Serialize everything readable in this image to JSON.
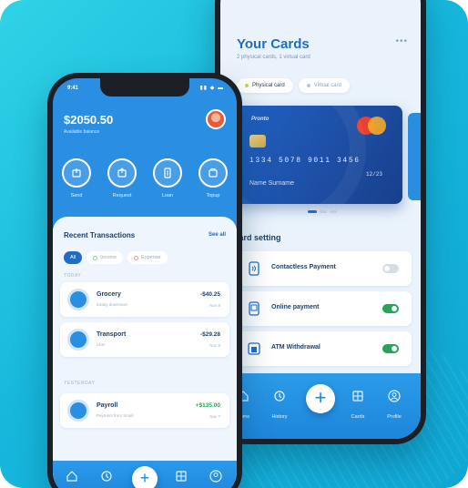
{
  "back_phone": {
    "title": "Your Cards",
    "subtitle": "2 physical cards, 1 virtual card",
    "menu_glyph": "•••",
    "tabs": [
      {
        "label": "Physical card",
        "active": true
      },
      {
        "label": "Virtual card",
        "active": false
      }
    ],
    "card": {
      "brand": "Pronto",
      "number": "1334  5078  9011  3456",
      "expiry": "12/23",
      "holder": "Name Surname",
      "network_icon": "mastercard-icon"
    },
    "settings_title": "Card setting",
    "settings": [
      {
        "label": "Contactless Payment",
        "icon": "contactless-icon",
        "enabled": false
      },
      {
        "label": "Online payment",
        "icon": "online-payment-icon",
        "enabled": true
      },
      {
        "label": "ATM Withdrawal",
        "icon": "atm-icon",
        "enabled": true
      }
    ],
    "nav": [
      {
        "label": "Home",
        "icon": "home-icon"
      },
      {
        "label": "History",
        "icon": "history-icon"
      },
      {
        "label": "Cards",
        "icon": "cards-icon"
      },
      {
        "label": "Profile",
        "icon": "profile-icon"
      }
    ],
    "fab_glyph": "+"
  },
  "front_phone": {
    "status_time": "9:41",
    "status_icons": "▮▮ ◆ ▬",
    "balance": "$2050.50",
    "balance_label": "Available balance",
    "actions": [
      {
        "label": "Send",
        "icon": "send-icon"
      },
      {
        "label": "Request",
        "icon": "request-icon"
      },
      {
        "label": "Loan",
        "icon": "loan-icon"
      },
      {
        "label": "Topup",
        "icon": "topup-icon"
      }
    ],
    "transactions_title": "Recent Transactions",
    "see_all": "See all",
    "filters": [
      {
        "label": "All",
        "active": true
      },
      {
        "label": "Income",
        "active": false
      },
      {
        "label": "Expense",
        "active": false
      }
    ],
    "section_today": "TODAY",
    "section_yesterday": "YESTERDAY",
    "today": [
      {
        "name": "Grocery",
        "desc": "Eataly downtown",
        "amount": "-$40.25",
        "date": "Nov 8",
        "icon": "grocery-icon"
      },
      {
        "name": "Transport",
        "desc": "Uber",
        "amount": "-$29.28",
        "date": "Nov 8",
        "icon": "transport-icon"
      }
    ],
    "yesterday": [
      {
        "name": "Payroll",
        "desc": "Payment from Small",
        "amount": "+$135.00",
        "date": "Nov 7",
        "icon": "payroll-icon"
      }
    ],
    "fab_glyph": "+"
  },
  "colors": {
    "background": "#17b7dc",
    "primary": "#1f6dc6",
    "toggle_on": "#27a35a"
  }
}
